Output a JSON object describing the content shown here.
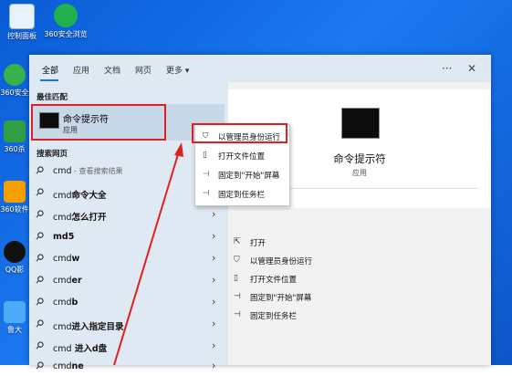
{
  "desktop": {
    "icons": [
      {
        "label": "控制面板"
      },
      {
        "label": "360安全浏览"
      }
    ],
    "side_labels": [
      "360安全",
      "360杀",
      "360软件",
      "QQ影",
      "鲁大"
    ]
  },
  "tabs": [
    "全部",
    "应用",
    "文档",
    "网页",
    "更多 ▾"
  ],
  "window": {
    "more": "···",
    "close": "✕"
  },
  "best_match": {
    "section": "最佳匹配",
    "title": "命令提示符",
    "subtitle": "应用"
  },
  "web_search": {
    "section": "搜索网页",
    "rows": [
      {
        "prefix": "cmd",
        "suffix": " - 查看搜索结果"
      },
      {
        "prefix": "cmd",
        "suffix": "命令大全"
      },
      {
        "prefix": "cmd",
        "suffix": "怎么打开"
      },
      {
        "prefix": "md5",
        "suffix": ""
      },
      {
        "prefix": "cmd",
        "suffix": "w"
      },
      {
        "prefix": "cmd",
        "suffix": "er"
      },
      {
        "prefix": "cmd",
        "suffix": "b"
      },
      {
        "prefix": "cmd",
        "suffix": "进入指定目录"
      },
      {
        "prefix": "cmd",
        "suffix": " 进入d盘"
      },
      {
        "prefix": "cmd",
        "suffix": "ne"
      }
    ]
  },
  "context_menu": [
    {
      "icon": "⛉",
      "label": "以管理员身份运行"
    },
    {
      "icon": "▯",
      "label": "打开文件位置"
    },
    {
      "icon": "⊣",
      "label": "固定到\"开始\"屏幕"
    },
    {
      "icon": "⊣",
      "label": "固定到任务栏"
    }
  ],
  "detail": {
    "title": "命令提示符",
    "subtitle": "应用",
    "actions": [
      {
        "icon": "⇱",
        "label": "打开"
      },
      {
        "icon": "⛉",
        "label": "以管理员身份运行"
      },
      {
        "icon": "▯",
        "label": "打开文件位置"
      },
      {
        "icon": "⊣",
        "label": "固定到\"开始\"屏幕"
      },
      {
        "icon": "⊣",
        "label": "固定到任务栏"
      }
    ]
  },
  "colors": {
    "highlight": "#e02020",
    "accent": "#1a73e8"
  }
}
